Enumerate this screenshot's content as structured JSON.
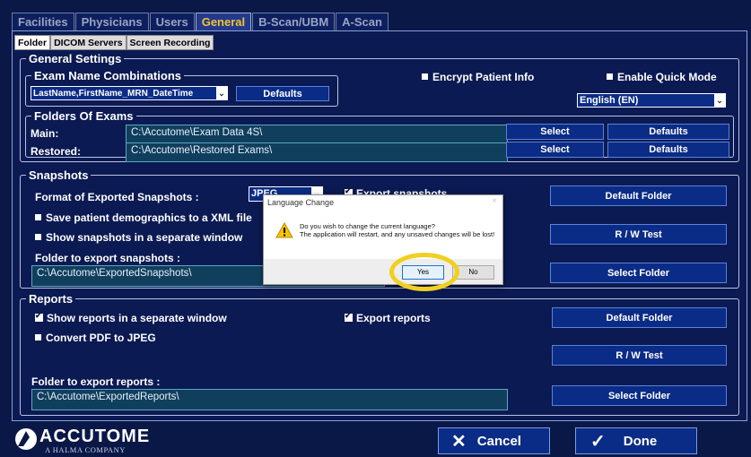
{
  "top_tabs": [
    "Facilities",
    "Physicians",
    "Users",
    "General",
    "B-Scan/UBM",
    "A-Scan"
  ],
  "active_top_tab": "General",
  "sub_tabs": [
    "Folder",
    "DICOM Servers",
    "Screen Recording"
  ],
  "general": {
    "legend": "General Settings",
    "exam_legend": "Exam Name Combinations",
    "exam_combo_value": "LastName,FirstName_MRN_DateTime",
    "defaults_label": "Defaults",
    "encrypt_label": "Encrypt Patient Info",
    "quick_mode_label": "Enable Quick Mode",
    "language_value": "English (EN)"
  },
  "folders": {
    "legend": "Folders Of Exams",
    "main_label": "Main:",
    "main_path": "C:\\Accutome\\Exam Data 4S\\",
    "restored_label": "Restored:",
    "restored_path": "C:\\Accutome\\Restored Exams\\",
    "select_label": "Select",
    "defaults_label": "Defaults"
  },
  "snapshots": {
    "legend": "Snapshots",
    "format_label": "Format of Exported Snapshots :",
    "format_value": "JPEG",
    "export_label": "Export snapshots",
    "save_xml_label": "Save patient demographics to a XML file",
    "separate_label": "Show snapshots in a separate window",
    "folder_label": "Folder to export snapshots :",
    "folder_path": "C:\\Accutome\\ExportedSnapshots\\",
    "default_folder_label": "Default Folder",
    "rw_test_label": "R / W Test",
    "select_folder_label": "Select Folder"
  },
  "reports": {
    "legend": "Reports",
    "separate_label": "Show reports in a separate window",
    "export_label": "Export reports",
    "convert_label": "Convert PDF to JPEG",
    "folder_label": "Folder to export reports :",
    "folder_path": "C:\\Accutome\\ExportedReports\\",
    "default_folder_label": "Default Folder",
    "rw_test_label": "R / W Test",
    "select_folder_label": "Select Folder"
  },
  "dialog": {
    "title": "Language Change",
    "close": "×",
    "message": "Do you wish to change the current language?\nThe application will restart, and any unsaved changes will be lost!",
    "yes_label": "Yes",
    "no_label": "No"
  },
  "footer": {
    "brand": "ACCUTOME",
    "brand_sub": "A HALMA COMPANY",
    "cancel_label": "Cancel",
    "done_label": "Done"
  },
  "colors": {
    "background": "#0a1847",
    "button": "#0b2c86",
    "path_box": "#103f5e",
    "active_tab_text": "#f3c431",
    "highlight": "#f0d020"
  }
}
